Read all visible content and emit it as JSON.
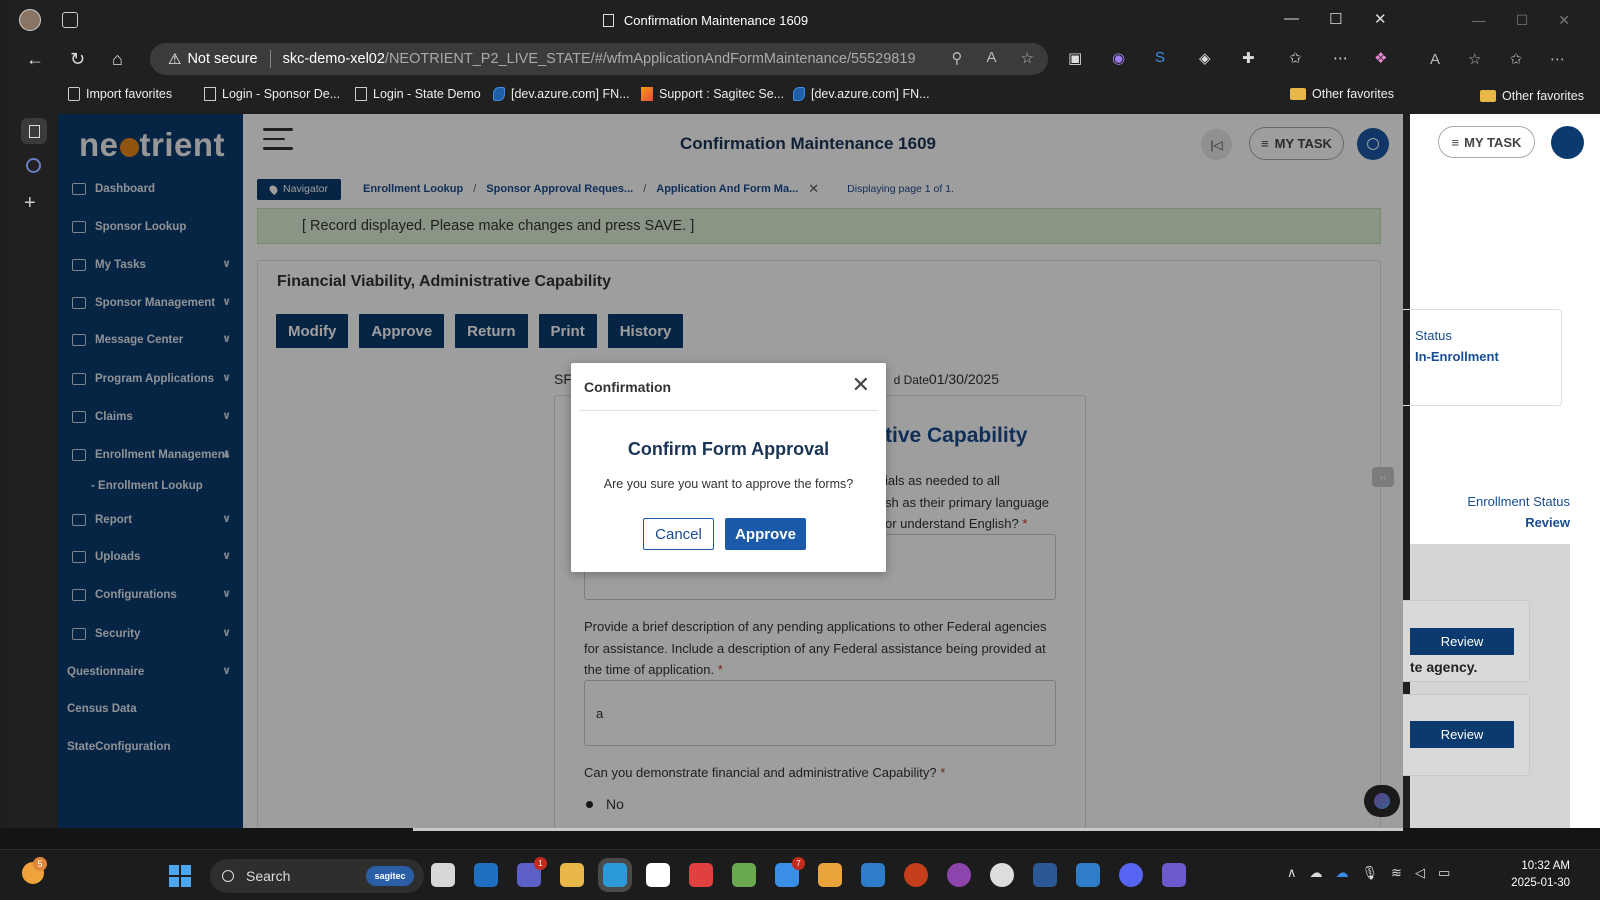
{
  "browser": {
    "window_title": "Confirmation Maintenance 1609",
    "not_secure": "Not secure",
    "url_host": "skc-demo-xel02",
    "url_path": "/NEOTRIENT_P2_LIVE_STATE/#/wfmApplicationAndFormMaintenance/55529819",
    "favorites": [
      "Import favorites",
      "Login - Sponsor De...",
      "Login - State Demo",
      "[dev.azure.com] FN...",
      "Support : Sagitec Se...",
      "[dev.azure.com] FN..."
    ],
    "other_favorites": "Other favorites"
  },
  "app": {
    "logo": {
      "part1": "ne",
      "part2": "trient"
    },
    "page_title": "Confirmation Maintenance 1609",
    "my_task": "MY TASK"
  },
  "sidebar": {
    "items": [
      {
        "label": "Dashboard"
      },
      {
        "label": "Sponsor Lookup"
      },
      {
        "label": "My Tasks"
      },
      {
        "label": "Sponsor Management"
      },
      {
        "label": "Message Center"
      },
      {
        "label": "Program Applications"
      },
      {
        "label": "Claims"
      },
      {
        "label": "Enrollment Management"
      },
      {
        "label": "- Enrollment Lookup"
      },
      {
        "label": "Report"
      },
      {
        "label": "Uploads"
      },
      {
        "label": "Configurations"
      },
      {
        "label": "Security"
      },
      {
        "label": "Questionnaire"
      },
      {
        "label": "Census Data"
      },
      {
        "label": "StateConfiguration"
      }
    ]
  },
  "breadcrumb": {
    "navigator": "Navigator",
    "items": [
      "Enrollment Lookup",
      "Sponsor Approval Reques...",
      "Application And Form Ma..."
    ],
    "displaying": "Displaying page 1 of 1."
  },
  "notice": "[ Record displayed. Please make changes and press SAVE. ]",
  "section": {
    "title": "Financial Viability, Administrative Capability",
    "buttons": [
      "Modify",
      "Approve",
      "Return",
      "Print",
      "History"
    ],
    "sf_label": "SF",
    "date_label": "d Date",
    "date_value": "01/30/2025",
    "form_heading": "tive Capability"
  },
  "form": {
    "q1_lines": [
      "ials as needed to all",
      "sh as their primary language",
      "or understand English?"
    ],
    "q2": "Provide a brief description of any pending applications to other Federal agencies for assistance. Include a description of any Federal assistance being provided at the time of application.",
    "q2_answer": "a",
    "q3": "Can you demonstrate financial and administrative Capability?",
    "q3_answer": "No",
    "required_mark": "*"
  },
  "dialog": {
    "header": "Confirmation",
    "title": "Confirm Form Approval",
    "message": "Are you sure you want to approve the forms?",
    "cancel": "Cancel",
    "approve": "Approve"
  },
  "bg_window": {
    "my_task": "MY TASK",
    "status_label": "Status",
    "status_value": "In-Enrollment",
    "enrollment_status_label": "Enrollment Status",
    "enrollment_status_value": "Review",
    "review_button": "Review",
    "agency_text": "te agency."
  },
  "taskbar": {
    "search": "Search",
    "search_badge": "sagitec",
    "weather_badge": "5",
    "teams_badge": "1",
    "todo_badge": "7",
    "time": "10:32 AM",
    "date": "2025-01-30"
  }
}
